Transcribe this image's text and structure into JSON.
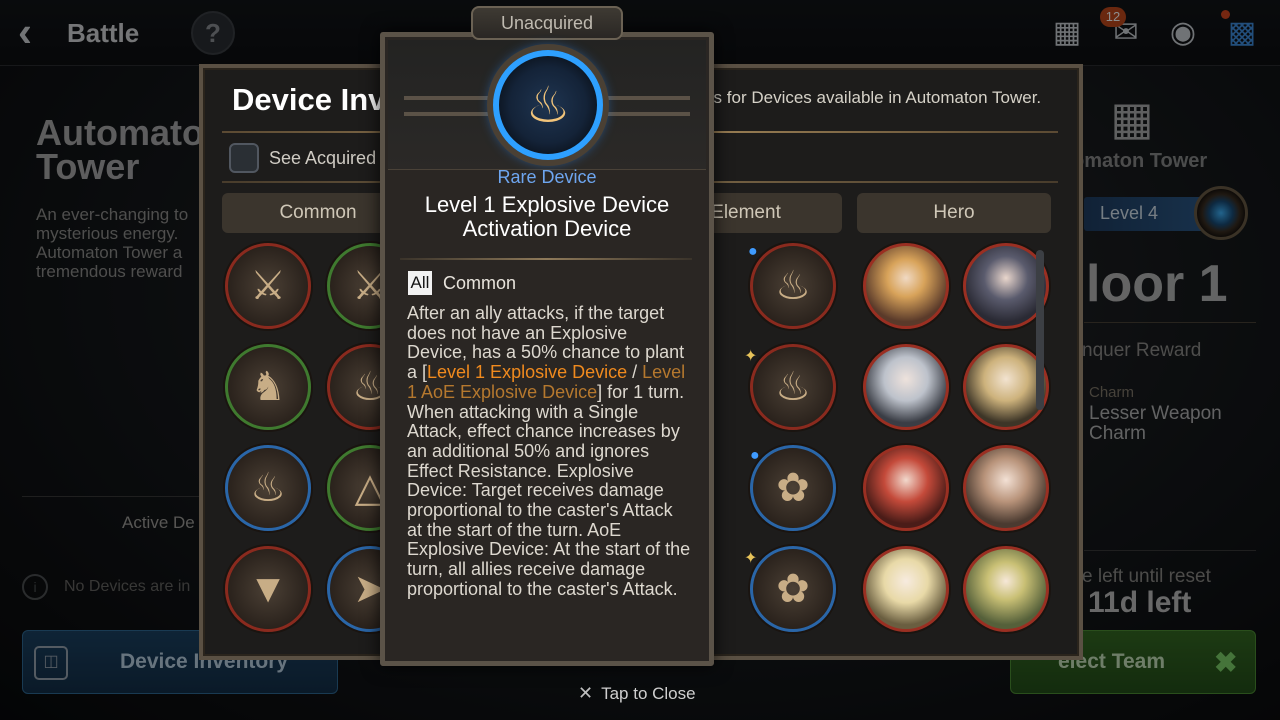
{
  "topbar": {
    "back_label": "Battle",
    "help_glyph": "?",
    "mail_badge": "12",
    "icons": [
      "team-icon",
      "mail-icon",
      "chat-icon",
      "menu-grid-icon"
    ]
  },
  "left_panel": {
    "title": "Automaton Tower",
    "description": "An ever-changing to mysterious energy. Automaton Tower a tremendous reward",
    "active_label": "Active De",
    "empty_note": "No Devices are in",
    "button_label": "Device Inventory"
  },
  "right_panel": {
    "name": "omaton Tower",
    "level": "Level 4",
    "floor": "loor 1",
    "conquer_label": "nquer Reward",
    "charm_label": "Charm",
    "charm_name": "Lesser Weapon Charm",
    "reset_label": "e left until reset",
    "days_left": "11d left",
    "button_label": "elect Team"
  },
  "inventory": {
    "title": "Device Inve",
    "subtitle": "ils for Devices available in Automaton Tower.",
    "see_acquired": "See Acquired",
    "tabs": [
      "Common",
      "Element",
      "Hero"
    ]
  },
  "popup": {
    "tab": "Unacquired",
    "rarity": "Rare Device",
    "name_line1": "Level 1 Explosive Device",
    "name_line2": "Activation Device",
    "tag_all": "All",
    "tag_common": "Common",
    "desc_pre": "After an ally attacks, if the target does not have an Explosive Device, has a 50% chance to plant a [",
    "desc_hl1": "Level 1 Explosive Device",
    "desc_sep": " / ",
    "desc_hl2": "Level 1 AoE Explosive Device",
    "desc_post": "] for 1 turn. When attacking with a Single Attack, effect chance increases by an additional 50% and ignores Effect Resistance. Explosive Device: Target receives damage proportional to the caster's Attack at the start of the turn. AoE Explosive Device: At the start of the turn, all allies receive damage proportional to the caster's Attack."
  },
  "footer": {
    "close_label": "Tap to Close"
  }
}
